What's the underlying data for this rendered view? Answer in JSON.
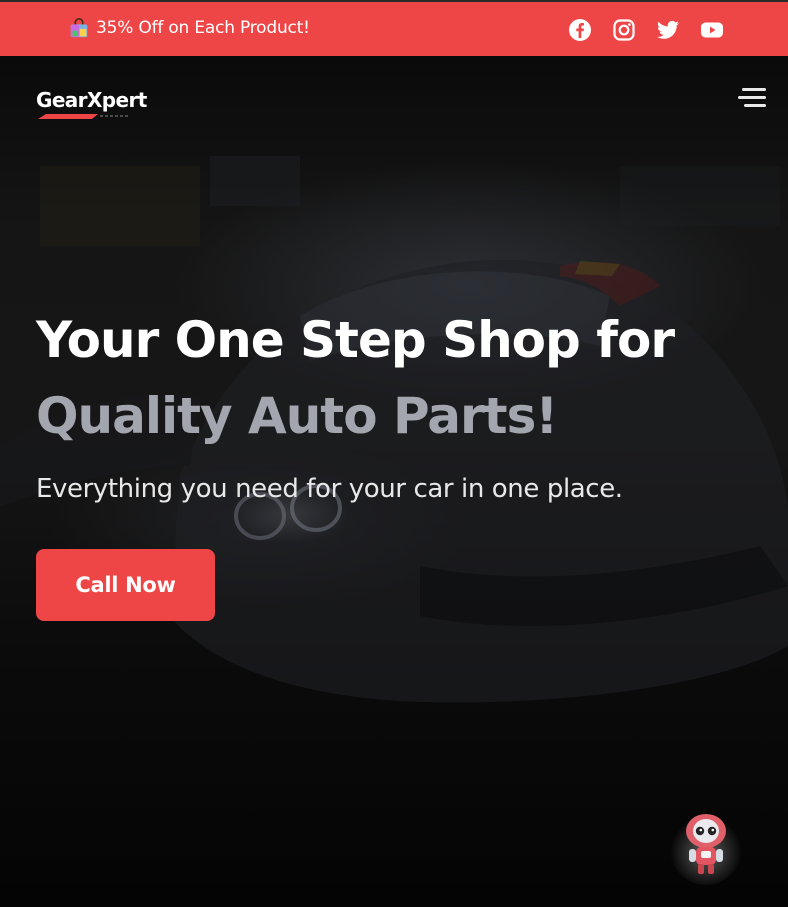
{
  "promo": {
    "text": "35% Off on Each Product!",
    "icon": "shopping-bag-emoji"
  },
  "social": [
    "facebook-icon",
    "instagram-icon",
    "twitter-icon",
    "youtube-icon"
  ],
  "nav": {
    "logo": "GearXpert",
    "menu_icon": "hamburger-menu-icon"
  },
  "hero": {
    "headline_line1": "Your One Step Shop for",
    "headline_line2": "Quality Auto Parts!",
    "subheadline": "Everything you need for your car in one place.",
    "cta_label": "Call Now"
  },
  "chat_widget": {
    "icon": "robot-assistant-icon"
  },
  "colors": {
    "accent": "#ee4646",
    "headline_muted": "#a3a6ae",
    "background": "#050505"
  }
}
